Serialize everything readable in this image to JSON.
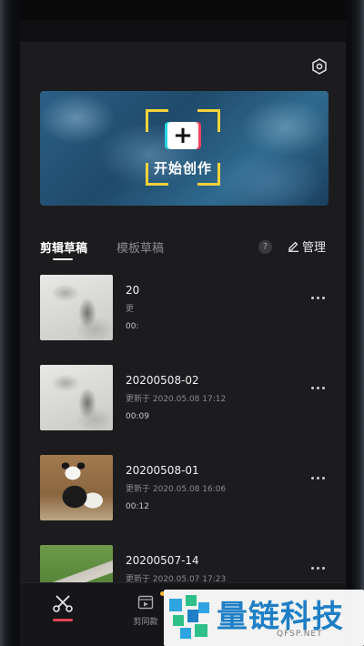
{
  "banner": {
    "create_label": "开始创作",
    "plus": "+"
  },
  "tabs": [
    {
      "label": "剪辑草稿",
      "active": true
    },
    {
      "label": "模板草稿",
      "active": false
    }
  ],
  "toolbar": {
    "help": "?",
    "manage_label": "管理"
  },
  "drafts": [
    {
      "title": "20",
      "updated": "更",
      "duration": "00:",
      "thumb": "ink"
    },
    {
      "title": "20200508-02",
      "updated": "更新于 2020.05.08 17:12",
      "duration": "00:09",
      "thumb": "ink"
    },
    {
      "title": "20200508-01",
      "updated": "更新于 2020.05.08 16:06",
      "duration": "00:12",
      "thumb": "panda"
    },
    {
      "title": "20200507-14",
      "updated": "更新于 2020.05.07 17:23",
      "duration": "",
      "thumb": "road"
    }
  ],
  "bottom_nav": {
    "edit_icon": "scissors-icon",
    "template_label": "剪同款",
    "template_icon": "film-play-icon"
  },
  "watermark": {
    "text": "量链科技",
    "sub": "QFSP.NET"
  },
  "colors": {
    "accent_yellow": "#f3d23a",
    "active_indicator": "#e04450",
    "watermark_blue": "#1e7fc6"
  }
}
